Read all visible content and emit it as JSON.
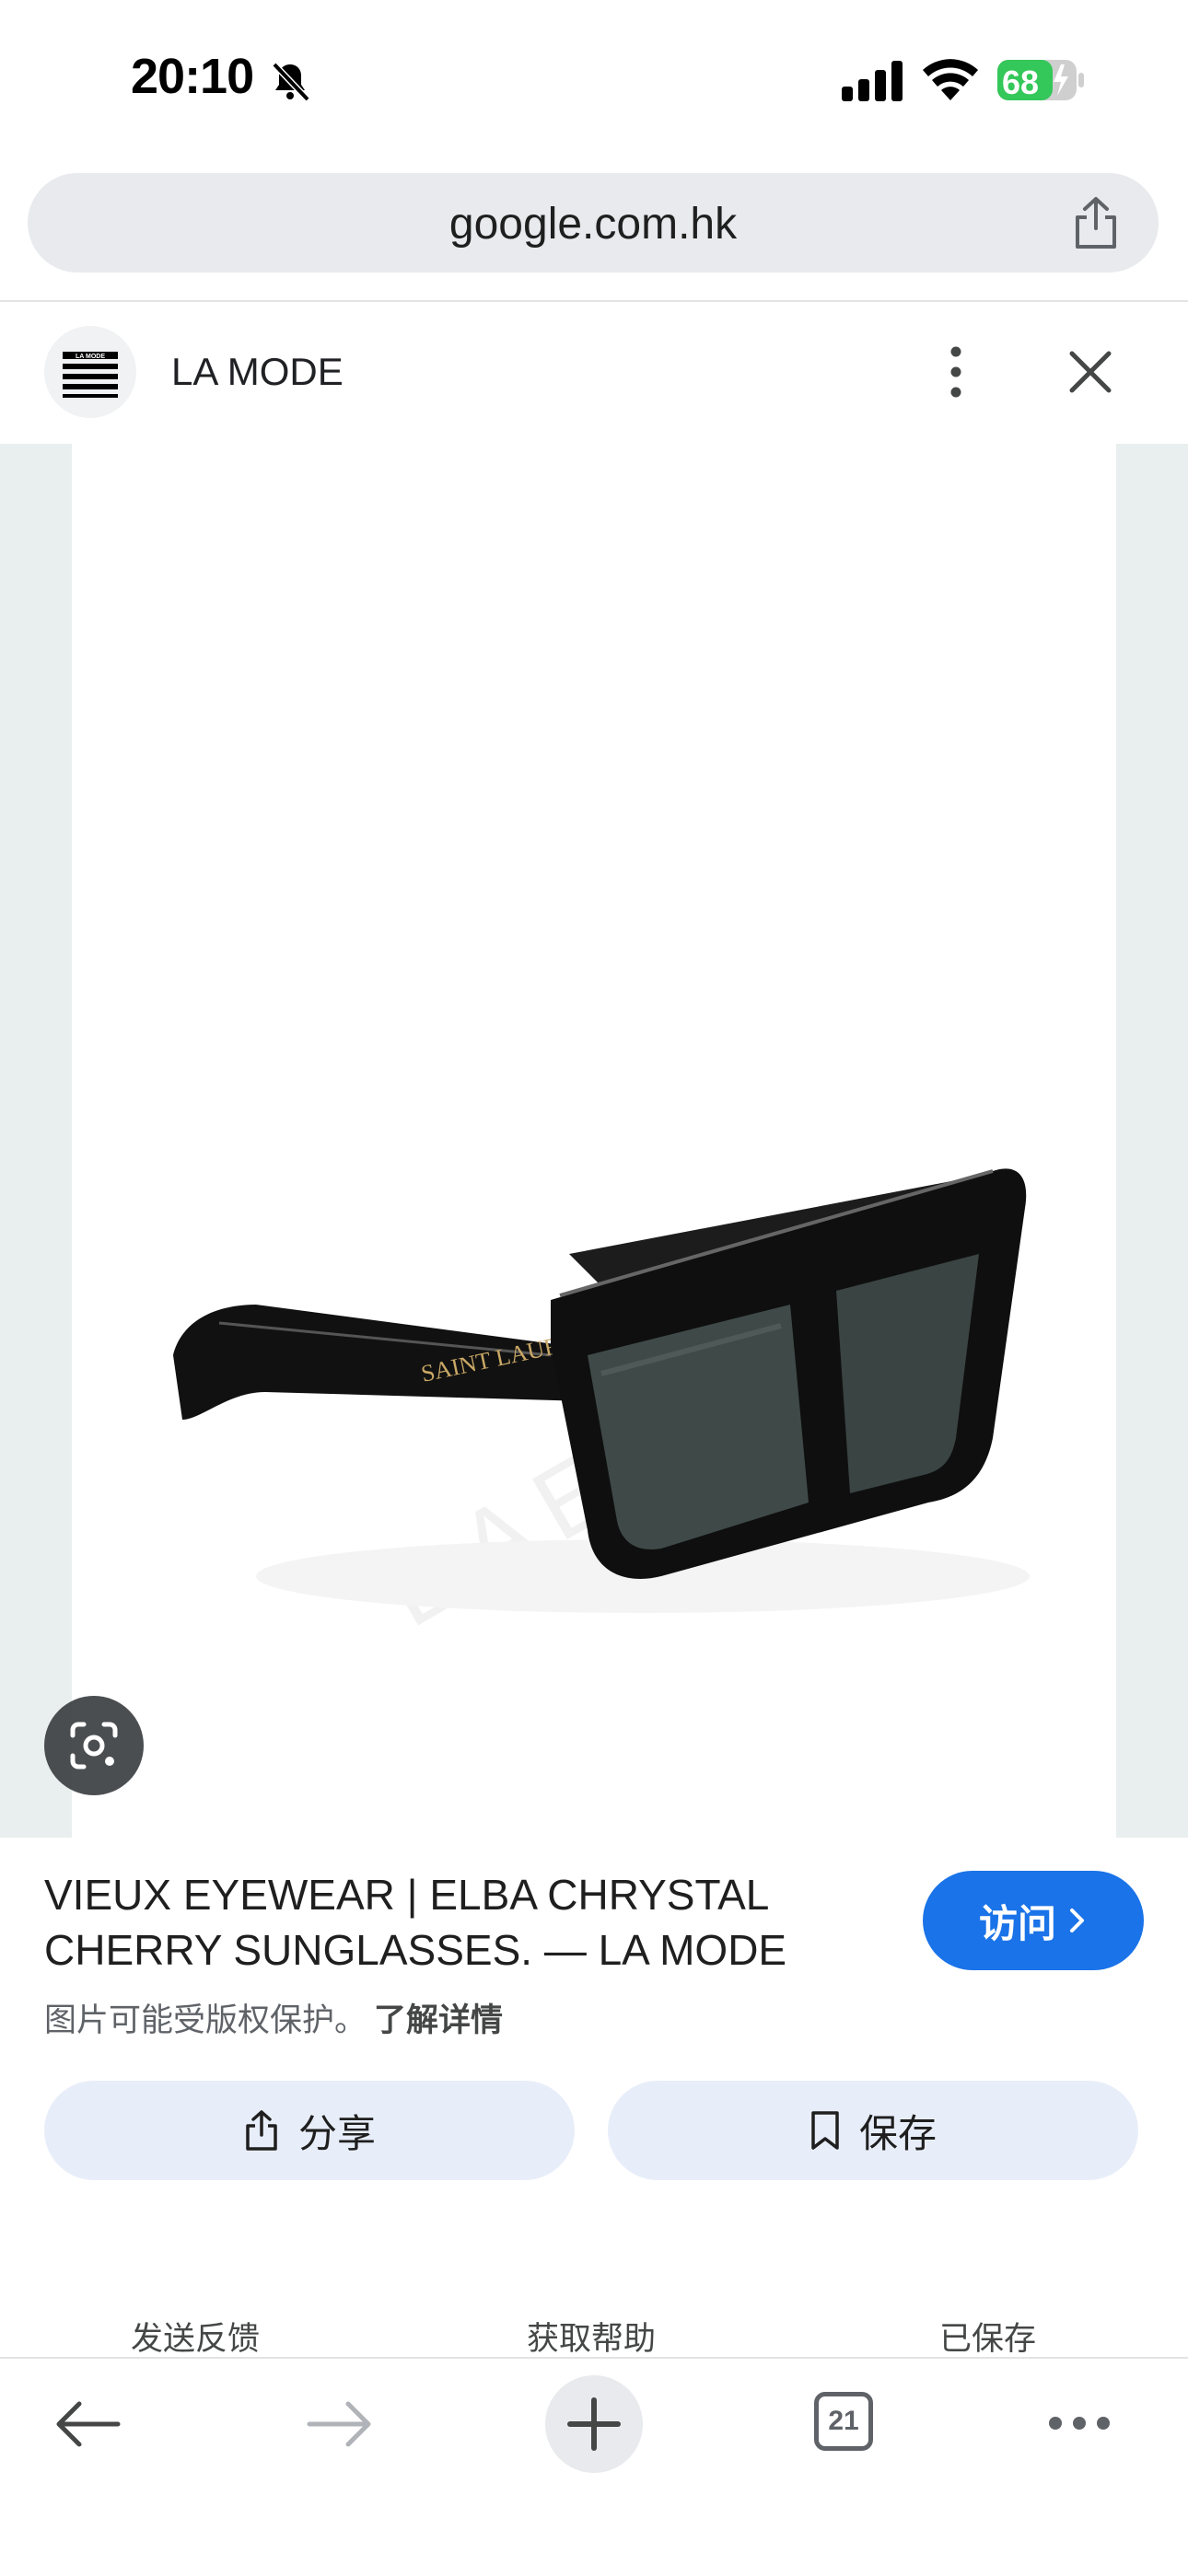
{
  "status": {
    "time": "20:10",
    "battery": "68"
  },
  "url_bar": {
    "domain": "google.com.hk"
  },
  "source": {
    "name": "LA MODE",
    "logo_text": "LA MODE"
  },
  "result": {
    "title_line1": "VIEUX EYEWEAR | ELBA CHRYSTAL",
    "title_line2": "CHERRY SUNGLASSES. — LA MODE",
    "copyright": "图片可能受版权保护。",
    "learn_more": "了解详情",
    "visit_label": "访问",
    "share_label": "分享",
    "save_label": "保存"
  },
  "image": {
    "temple_brand": "SAINT LAURENT",
    "watermark": "BAEIIAEGI"
  },
  "footer": {
    "feedback": "发送反馈",
    "help": "获取帮助",
    "saved": "已保存"
  },
  "toolbar": {
    "tab_count": "21"
  },
  "colors": {
    "accent": "#1a73e8",
    "chip_bg": "#e8eef9",
    "image_bg": "#e9efee"
  }
}
